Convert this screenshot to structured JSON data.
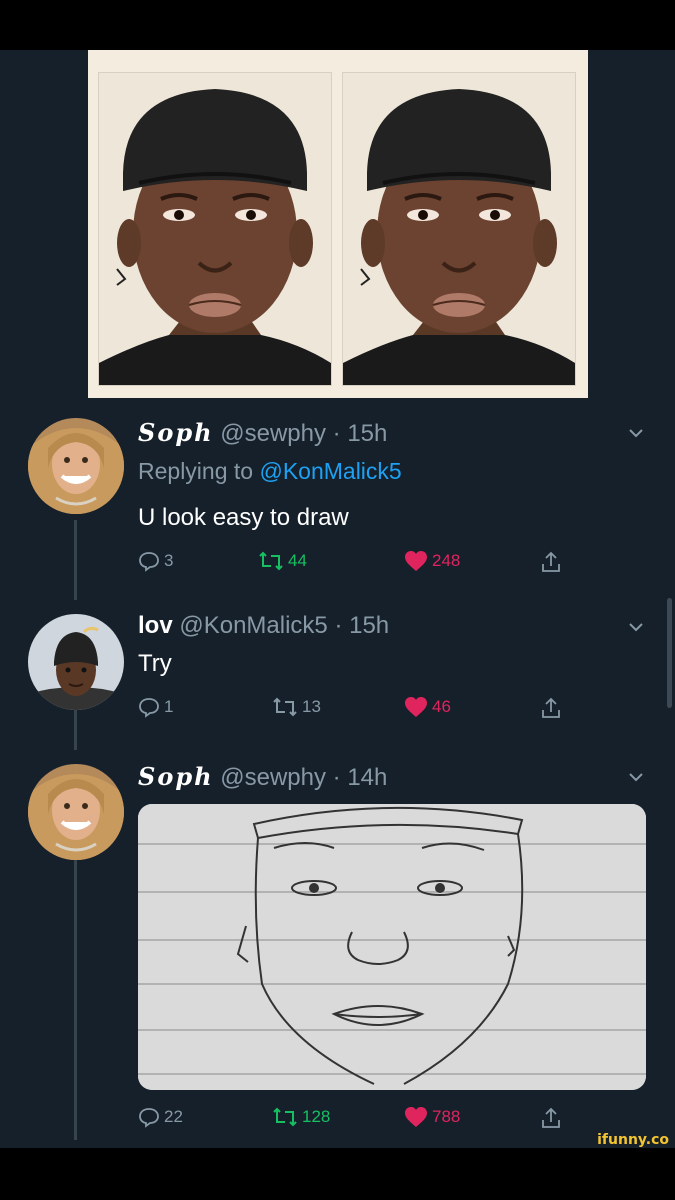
{
  "colors": {
    "background": "#15202b",
    "muted": "#8899a6",
    "link": "#1da1f2",
    "retweet": "#17bf63",
    "like": "#e0245e"
  },
  "watermark": "ifunny.co",
  "tweets": [
    {
      "display_name": "Soph",
      "handle": "@sewphy",
      "time": "· 15h",
      "replying_label": "Replying to",
      "replying_to": "@KonMalick5",
      "text": "U look easy to draw",
      "replies": "3",
      "retweets": "44",
      "likes": "248",
      "liked": true
    },
    {
      "display_name": "lov",
      "handle": "@KonMalick5",
      "time": "· 15h",
      "text": "Try",
      "replies": "1",
      "retweets": "13",
      "likes": "46",
      "liked": true
    },
    {
      "display_name": "Soph",
      "handle": "@sewphy",
      "time": "· 14h",
      "replies": "22",
      "retweets": "128",
      "likes": "788",
      "liked": true
    }
  ]
}
